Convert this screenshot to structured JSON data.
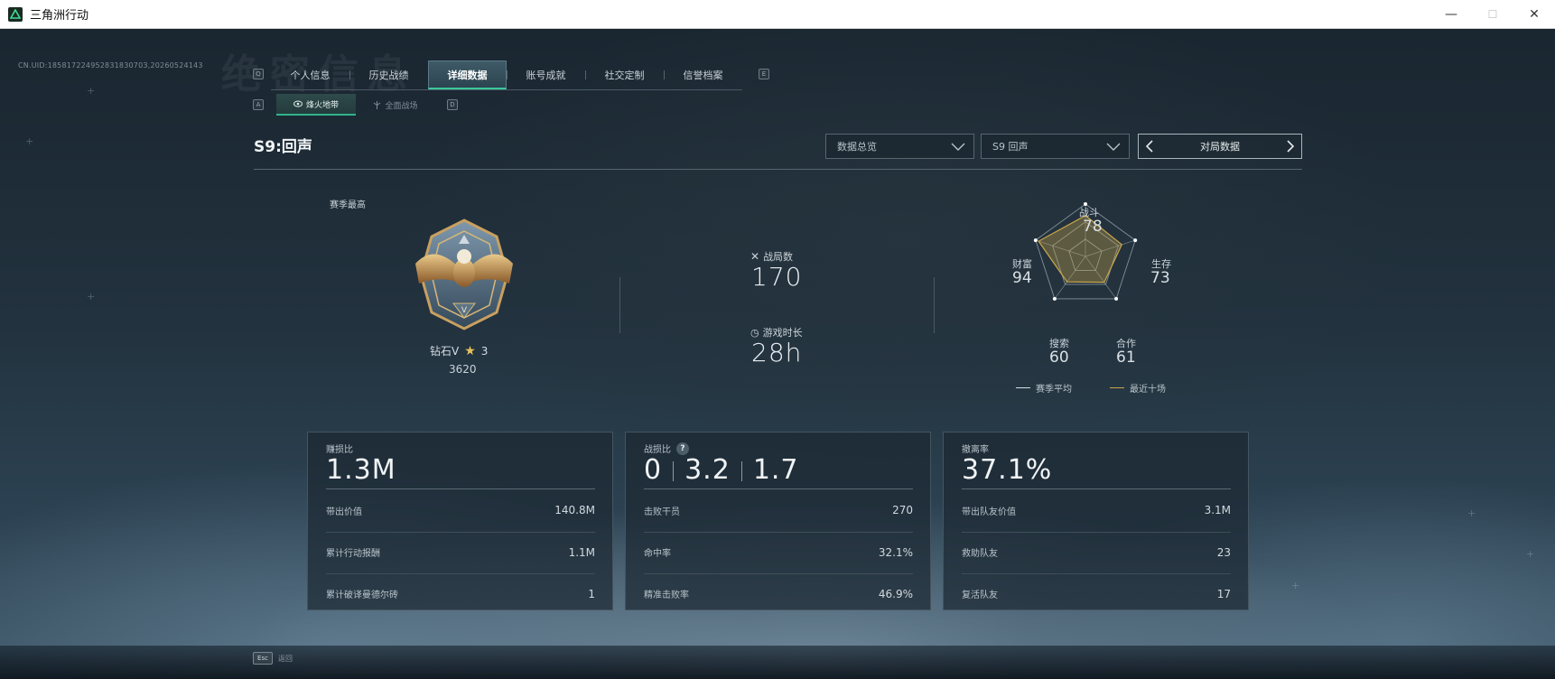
{
  "window": {
    "title": "三角洲行动",
    "controls": {
      "minimize": "—",
      "maximize": "☐",
      "close": "✕"
    }
  },
  "uid": "CN.UID:18581722495283183070З,20260524143",
  "background_title": "绝密信息",
  "tabs": {
    "key_left": "Q",
    "key_right": "E",
    "items": [
      {
        "label": "个人信息",
        "active": false
      },
      {
        "label": "历史战绩",
        "active": false
      },
      {
        "label": "详细数据",
        "active": true
      },
      {
        "label": "账号成就",
        "active": false
      },
      {
        "label": "社交定制",
        "active": false
      },
      {
        "label": "信誉档案",
        "active": false
      }
    ]
  },
  "subtabs": {
    "key_left": "A",
    "key_right": "D",
    "items": [
      {
        "label": "烽火地带",
        "icon": "fire-zone-icon",
        "active": true
      },
      {
        "label": "全面战场",
        "icon": "battlefield-icon",
        "active": false
      }
    ]
  },
  "season": {
    "title": "S9:回声"
  },
  "filters": {
    "data_overview": "数据总览",
    "season_select": "S9 回声",
    "match_data": "对局数据"
  },
  "rank": {
    "label": "赛季最高",
    "name": "钻石V",
    "stars": "3",
    "score": "3620"
  },
  "stats": {
    "matches_label": "战局数",
    "matches_value": "170",
    "playtime_label": "游戏时长",
    "playtime_value": "28h"
  },
  "radar": {
    "axes": [
      {
        "label": "战斗",
        "value": "78"
      },
      {
        "label": "生存",
        "value": "73"
      },
      {
        "label": "合作",
        "value": "61"
      },
      {
        "label": "搜索",
        "value": "60"
      },
      {
        "label": "财富",
        "value": "94"
      }
    ],
    "legend": {
      "season_avg": "赛季平均",
      "recent": "最近十场"
    },
    "colors": {
      "season_avg": "#d7dde1",
      "recent": "#c9a54a"
    }
  },
  "cards": [
    {
      "title": "赚损比",
      "big": "1.3M",
      "rows": [
        {
          "label": "带出价值",
          "value": "140.8M"
        },
        {
          "label": "累计行动报酬",
          "value": "1.1M"
        },
        {
          "label": "累计破译曼德尔砖",
          "value": "1"
        }
      ]
    },
    {
      "title": "战损比",
      "help": "?",
      "ratios": [
        "0",
        "3.2",
        "1.7"
      ],
      "rows": [
        {
          "label": "击败干员",
          "value": "270"
        },
        {
          "label": "命中率",
          "value": "32.1%"
        },
        {
          "label": "精准击败率",
          "value": "46.9%"
        }
      ]
    },
    {
      "title": "撤离率",
      "big": "37.1%",
      "rows": [
        {
          "label": "带出队友价值",
          "value": "3.1M"
        },
        {
          "label": "救助队友",
          "value": "23"
        },
        {
          "label": "复活队友",
          "value": "17"
        }
      ]
    }
  ],
  "footer": {
    "esc_key": "Esc",
    "esc_label": "返回"
  }
}
